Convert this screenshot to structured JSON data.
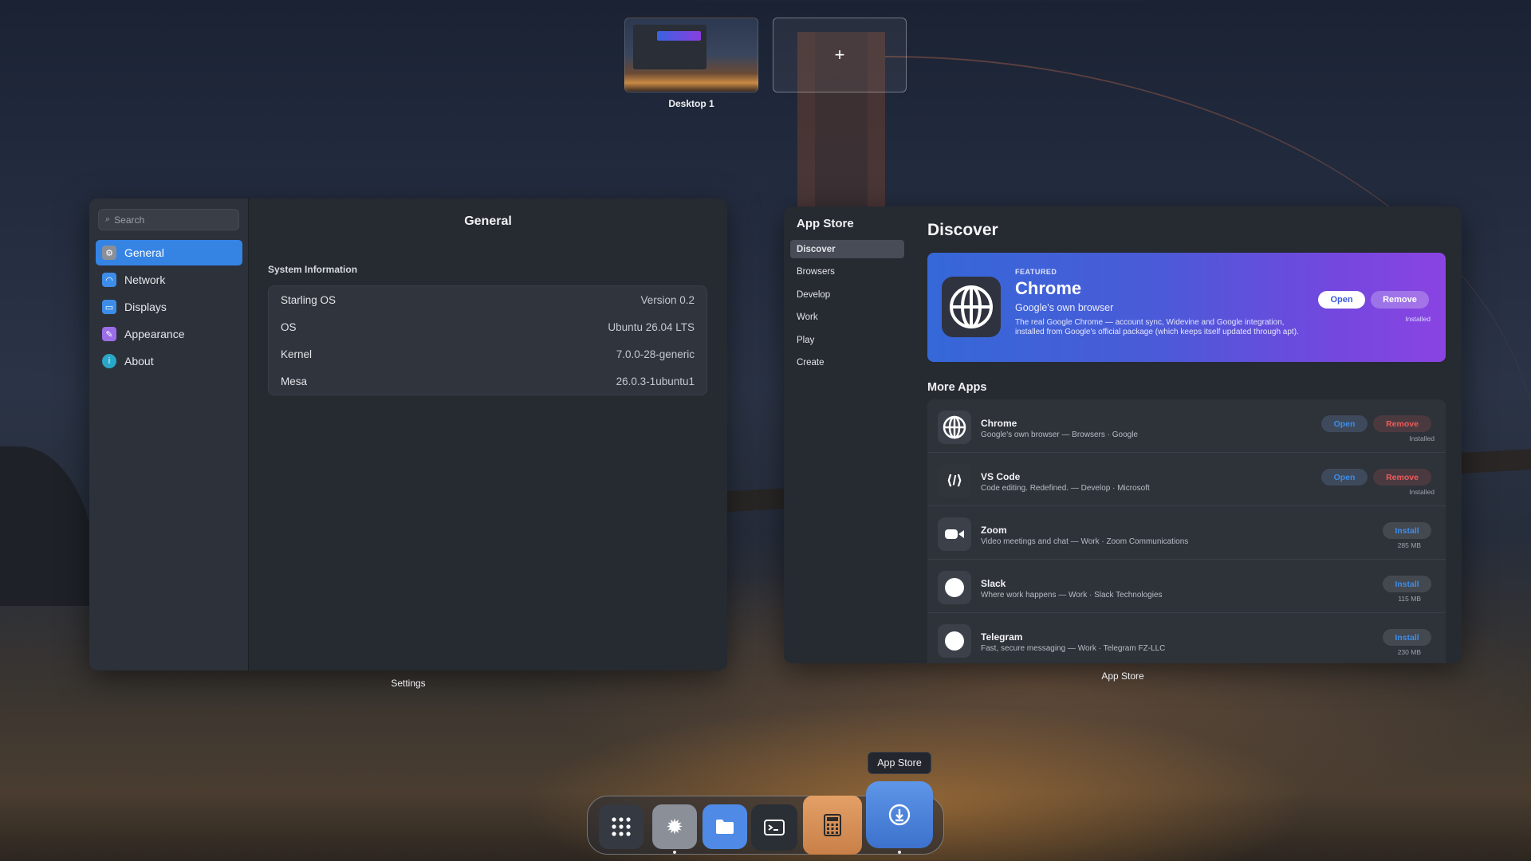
{
  "workspaces": {
    "items": [
      {
        "label": "Desktop 1"
      }
    ],
    "add_label": "+"
  },
  "settings": {
    "caption": "Settings",
    "search_placeholder": "Search",
    "title": "General",
    "nav": [
      {
        "label": "General",
        "icon": "gear-icon",
        "color": "#8a8f98",
        "active": true
      },
      {
        "label": "Network",
        "icon": "wifi-icon",
        "color": "#3d8de8"
      },
      {
        "label": "Displays",
        "icon": "monitor-icon",
        "color": "#3d8de8"
      },
      {
        "label": "Appearance",
        "icon": "brush-icon",
        "color": "#9b6ee8"
      },
      {
        "label": "About",
        "icon": "info-icon",
        "color": "#2aa6c8"
      }
    ],
    "section_title": "System Information",
    "rows": [
      {
        "label": "Starling OS",
        "value": "Version 0.2"
      },
      {
        "label": "OS",
        "value": "Ubuntu 26.04 LTS"
      },
      {
        "label": "Kernel",
        "value": "7.0.0-28-generic"
      },
      {
        "label": "Mesa",
        "value": "26.0.3-1ubuntu1"
      }
    ]
  },
  "store": {
    "caption": "App Store",
    "app_title": "App Store",
    "nav": [
      {
        "label": "Discover",
        "active": true
      },
      {
        "label": "Browsers"
      },
      {
        "label": "Develop"
      },
      {
        "label": "Work"
      },
      {
        "label": "Play"
      },
      {
        "label": "Create"
      }
    ],
    "page_title": "Discover",
    "featured": {
      "tag": "FEATURED",
      "name": "Chrome",
      "subtitle": "Google's own browser",
      "description": "The real Google Chrome — account sync, Widevine and Google integration, installed from Google's official package (which keeps itself updated through apt).",
      "open_label": "Open",
      "remove_label": "Remove",
      "status": "Installed",
      "icon": "globe-icon"
    },
    "more_title": "More Apps",
    "apps": [
      {
        "name": "Chrome",
        "desc": "Google's own browser — Browsers · Google",
        "icon": "globe-icon",
        "open_label": "Open",
        "remove_label": "Remove",
        "status": "Installed"
      },
      {
        "name": "VS Code",
        "desc": "Code editing. Redefined. — Develop · Microsoft",
        "icon": "code-icon",
        "open_label": "Open",
        "remove_label": "Remove",
        "status": "Installed"
      },
      {
        "name": "Zoom",
        "desc": "Video meetings and chat — Work · Zoom Communications",
        "icon": "video-camera-icon",
        "install_label": "Install",
        "size": "285 MB"
      },
      {
        "name": "Slack",
        "desc": "Where work happens — Work · Slack Technologies",
        "icon": "circle-icon",
        "install_label": "Install",
        "size": "115 MB"
      },
      {
        "name": "Telegram",
        "desc": "Fast, secure messaging — Work · Telegram FZ-LLC",
        "icon": "circle-icon",
        "install_label": "Install",
        "size": "230 MB"
      }
    ]
  },
  "dock": {
    "tooltip": "App Store",
    "items": [
      {
        "name": "app-grid-icon"
      },
      {
        "name": "settings-icon",
        "running": true
      },
      {
        "name": "files-icon"
      },
      {
        "name": "terminal-icon"
      },
      {
        "name": "calculator-icon"
      },
      {
        "name": "app-store-icon",
        "running": true
      }
    ]
  }
}
